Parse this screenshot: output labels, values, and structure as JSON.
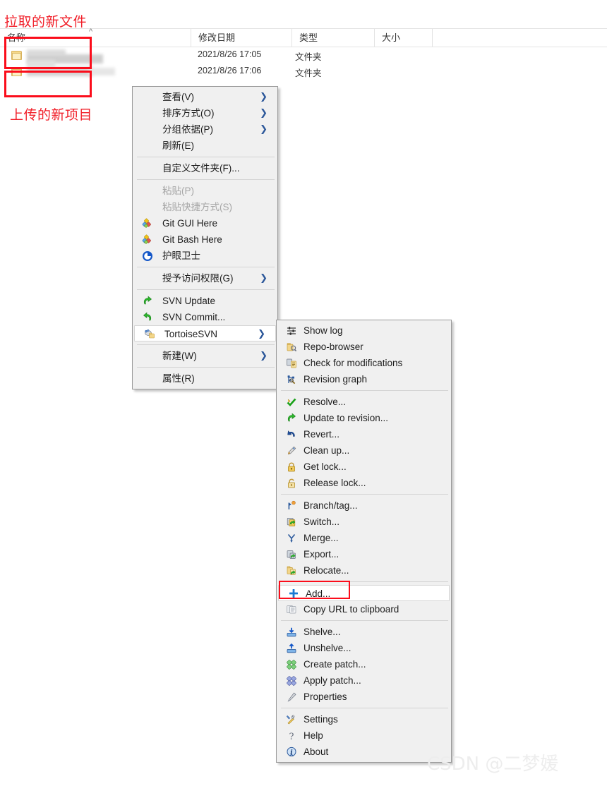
{
  "explorer": {
    "columns": [
      {
        "label": "名称"
      },
      {
        "label": "修改日期"
      },
      {
        "label": "类型"
      },
      {
        "label": "大小"
      },
      {
        "label": ""
      }
    ],
    "sort_caret": "^",
    "rows": [
      {
        "name": "",
        "date": "2021/8/26 17:05",
        "type": "文件夹",
        "size": "",
        "icon": "folder-icon"
      },
      {
        "name": "",
        "date": "2021/8/26 17:06",
        "type": "文件夹",
        "size": "",
        "icon": "folder-icon"
      }
    ]
  },
  "annotations": {
    "top_label": "拉取的新文件",
    "bottom_label": "上传的新项目",
    "highlight_color": "#fb0d1b",
    "text_color": "#f1202a"
  },
  "explorer_menu": {
    "items": [
      {
        "label": "查看(V)",
        "icon": "",
        "submenu": true,
        "disabled": false,
        "hovered": false,
        "sep_after": false
      },
      {
        "label": "排序方式(O)",
        "icon": "",
        "submenu": true,
        "disabled": false,
        "hovered": false,
        "sep_after": false
      },
      {
        "label": "分组依据(P)",
        "icon": "",
        "submenu": true,
        "disabled": false,
        "hovered": false,
        "sep_after": false
      },
      {
        "label": "刷新(E)",
        "icon": "",
        "submenu": false,
        "disabled": false,
        "hovered": false,
        "sep_after": true
      },
      {
        "label": "自定义文件夹(F)...",
        "icon": "",
        "submenu": false,
        "disabled": false,
        "hovered": false,
        "sep_after": true
      },
      {
        "label": "粘贴(P)",
        "icon": "",
        "submenu": false,
        "disabled": true,
        "hovered": false,
        "sep_after": false
      },
      {
        "label": "粘贴快捷方式(S)",
        "icon": "",
        "submenu": false,
        "disabled": true,
        "hovered": false,
        "sep_after": false
      },
      {
        "label": "Git GUI Here",
        "icon": "git-diamond-icon",
        "submenu": false,
        "disabled": false,
        "hovered": false,
        "sep_after": false
      },
      {
        "label": "Git Bash Here",
        "icon": "git-diamond-icon",
        "submenu": false,
        "disabled": false,
        "hovered": false,
        "sep_after": false
      },
      {
        "label": "护眼卫士",
        "icon": "eyecare-icon",
        "submenu": false,
        "disabled": false,
        "hovered": false,
        "sep_after": true
      },
      {
        "label": "授予访问权限(G)",
        "icon": "",
        "submenu": true,
        "disabled": false,
        "hovered": false,
        "sep_after": true
      },
      {
        "label": "SVN Update",
        "icon": "svn-update-icon",
        "submenu": false,
        "disabled": false,
        "hovered": false,
        "sep_after": false
      },
      {
        "label": "SVN Commit...",
        "icon": "svn-commit-icon",
        "submenu": false,
        "disabled": false,
        "hovered": false,
        "sep_after": false
      },
      {
        "label": "TortoiseSVN",
        "icon": "tortoise-icon",
        "submenu": true,
        "disabled": false,
        "hovered": true,
        "sep_after": true
      },
      {
        "label": "新建(W)",
        "icon": "",
        "submenu": true,
        "disabled": false,
        "hovered": false,
        "sep_after": true
      },
      {
        "label": "属性(R)",
        "icon": "",
        "submenu": false,
        "disabled": false,
        "hovered": false,
        "sep_after": false
      }
    ]
  },
  "tortoise_menu": {
    "items": [
      {
        "label": "Show log",
        "icon": "show-log-icon",
        "hovered": false,
        "sep_after": false
      },
      {
        "label": "Repo-browser",
        "icon": "repo-browser-icon",
        "hovered": false,
        "sep_after": false
      },
      {
        "label": "Check for modifications",
        "icon": "check-mods-icon",
        "hovered": false,
        "sep_after": false
      },
      {
        "label": "Revision graph",
        "icon": "revision-graph-icon",
        "hovered": false,
        "sep_after": true
      },
      {
        "label": "Resolve...",
        "icon": "resolve-icon",
        "hovered": false,
        "sep_after": false
      },
      {
        "label": "Update to revision...",
        "icon": "update-rev-icon",
        "hovered": false,
        "sep_after": false
      },
      {
        "label": "Revert...",
        "icon": "revert-icon",
        "hovered": false,
        "sep_after": false
      },
      {
        "label": "Clean up...",
        "icon": "cleanup-icon",
        "hovered": false,
        "sep_after": false
      },
      {
        "label": "Get lock...",
        "icon": "get-lock-icon",
        "hovered": false,
        "sep_after": false
      },
      {
        "label": "Release lock...",
        "icon": "release-lock-icon",
        "hovered": false,
        "sep_after": true
      },
      {
        "label": "Branch/tag...",
        "icon": "branch-tag-icon",
        "hovered": false,
        "sep_after": false
      },
      {
        "label": "Switch...",
        "icon": "switch-icon",
        "hovered": false,
        "sep_after": false
      },
      {
        "label": "Merge...",
        "icon": "merge-icon",
        "hovered": false,
        "sep_after": false
      },
      {
        "label": "Export...",
        "icon": "export-icon",
        "hovered": false,
        "sep_after": false
      },
      {
        "label": "Relocate...",
        "icon": "relocate-icon",
        "hovered": false,
        "sep_after": true
      },
      {
        "label": "Add...",
        "icon": "add-icon",
        "hovered": true,
        "sep_after": false
      },
      {
        "label": "Copy URL to clipboard",
        "icon": "copy-url-icon",
        "hovered": false,
        "sep_after": true
      },
      {
        "label": "Shelve...",
        "icon": "shelve-icon",
        "hovered": false,
        "sep_after": false
      },
      {
        "label": "Unshelve...",
        "icon": "unshelve-icon",
        "hovered": false,
        "sep_after": false
      },
      {
        "label": "Create patch...",
        "icon": "create-patch-icon",
        "hovered": false,
        "sep_after": false
      },
      {
        "label": "Apply patch...",
        "icon": "apply-patch-icon",
        "hovered": false,
        "sep_after": false
      },
      {
        "label": "Properties",
        "icon": "properties-icon",
        "hovered": false,
        "sep_after": true
      },
      {
        "label": "Settings",
        "icon": "settings-icon",
        "hovered": false,
        "sep_after": false
      },
      {
        "label": "Help",
        "icon": "help-icon",
        "hovered": false,
        "sep_after": false
      },
      {
        "label": "About",
        "icon": "about-icon",
        "hovered": false,
        "sep_after": false
      }
    ]
  },
  "watermark": {
    "text": "CSDN @二梦媛"
  }
}
